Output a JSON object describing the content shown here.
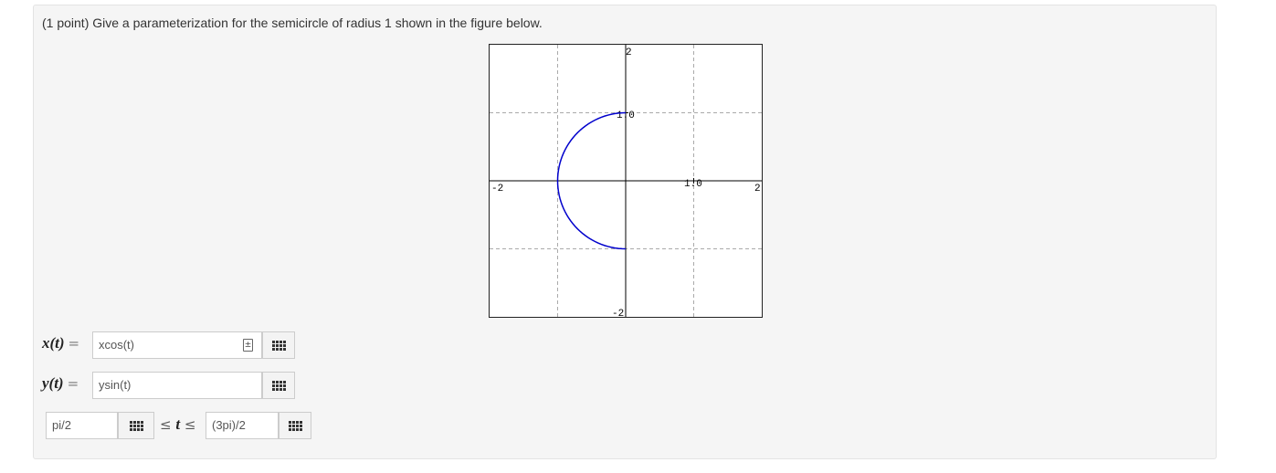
{
  "question": {
    "text": "(1 point) Give a parameterization for the semicircle of radius 1 shown in the figure below."
  },
  "graph": {
    "x_tick_labels": {
      "neg": "-2",
      "mid": "1.0",
      "pos": "2"
    },
    "y_tick_labels": {
      "neg": "-2",
      "mid": "1.0",
      "pos": "2"
    },
    "curve_color": "#0000cc",
    "grid_dash_color": "#aaaaaa"
  },
  "chart_data": {
    "type": "line",
    "xlim": [
      -2,
      2
    ],
    "ylim": [
      -2,
      2
    ],
    "grid": true,
    "series": [
      {
        "color": "#0000cc",
        "curve": "left half of unit circle, from (0,1) counterclockwise to (0,-1)",
        "x": [
          0,
          -0.38,
          -0.71,
          -0.92,
          -1.0,
          -0.92,
          -0.71,
          -0.38,
          0
        ],
        "y": [
          1,
          0.92,
          0.71,
          0.38,
          0,
          -0.38,
          -0.71,
          -0.92,
          -1
        ]
      }
    ]
  },
  "answers": {
    "x_label": "x(t)",
    "y_label": "y(t)",
    "equals": "=",
    "x_value": "xcos(t)",
    "y_value": "ysin(t)",
    "t_lower": "pi/2",
    "t_upper": "(3pi)/2",
    "leq": "≤",
    "t_var": "t"
  },
  "icons": {
    "palette": "equation-palette-grid-icon",
    "preview": "equation-preview-icon"
  }
}
